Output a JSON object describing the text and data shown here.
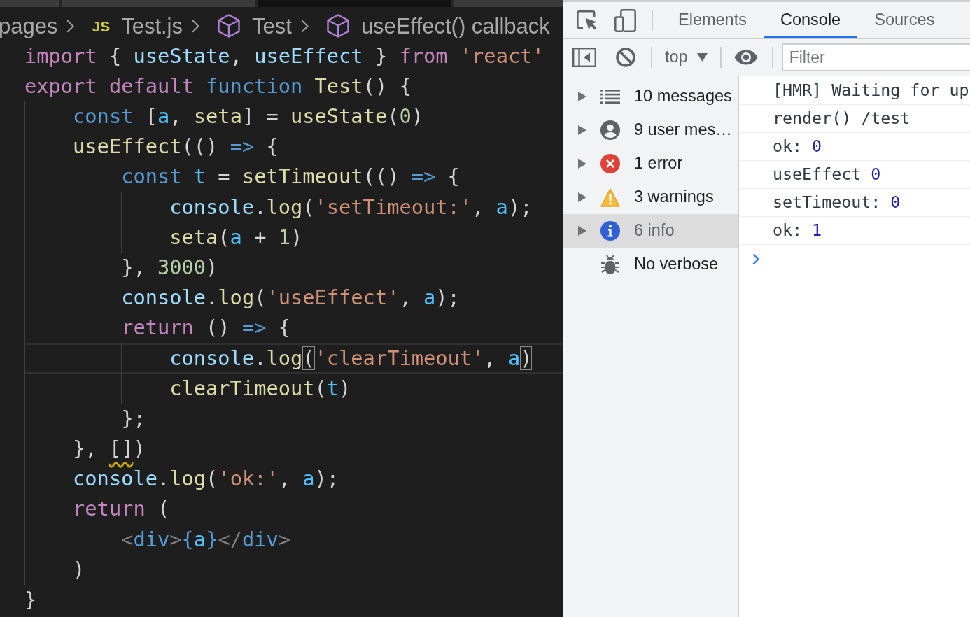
{
  "editor": {
    "tabs": [
      {
        "selected": false
      },
      {
        "selected": false
      },
      {
        "selected": true
      },
      {
        "selected": false
      }
    ],
    "breadcrumb": [
      {
        "kind": "folder",
        "label": "pages"
      },
      {
        "kind": "file",
        "icon_text": "JS",
        "label": "Test.js"
      },
      {
        "kind": "symbol",
        "label": "Test"
      },
      {
        "kind": "symbol",
        "label": "useEffect() callback"
      }
    ],
    "lines": [
      {
        "current": false,
        "tokens": [
          {
            "kind": "keyword",
            "text": "import"
          },
          {
            "kind": "punct",
            "text": " { "
          },
          {
            "kind": "variable",
            "text": "useState"
          },
          {
            "kind": "punct",
            "text": ", "
          },
          {
            "kind": "variable",
            "text": "useEffect"
          },
          {
            "kind": "punct",
            "text": " } "
          },
          {
            "kind": "keyword",
            "text": "from "
          },
          {
            "kind": "string",
            "text": "'react'"
          }
        ]
      },
      {
        "current": false,
        "tokens": [
          {
            "kind": "keyword",
            "text": "export default "
          },
          {
            "kind": "storage",
            "text": "function "
          },
          {
            "kind": "function",
            "text": "Test"
          },
          {
            "kind": "punct",
            "text": "() {"
          }
        ],
        "children": [
          {
            "current": false,
            "tokens": [
              {
                "kind": "storage",
                "text": "const "
              },
              {
                "kind": "punct",
                "text": "["
              },
              {
                "kind": "constant",
                "text": "a"
              },
              {
                "kind": "punct",
                "text": ", "
              },
              {
                "kind": "function",
                "text": "seta"
              },
              {
                "kind": "punct",
                "text": "] = "
              },
              {
                "kind": "function",
                "text": "useState"
              },
              {
                "kind": "punct",
                "text": "("
              },
              {
                "kind": "number",
                "text": "0"
              },
              {
                "kind": "punct",
                "text": ")"
              }
            ]
          },
          {
            "current": false,
            "tokens": [
              {
                "kind": "function",
                "text": "useEffect"
              },
              {
                "kind": "punct",
                "text": "(() "
              },
              {
                "kind": "storage",
                "text": "=> "
              },
              {
                "kind": "punct",
                "text": "{"
              }
            ],
            "children": [
              {
                "current": false,
                "tokens": [
                  {
                    "kind": "storage",
                    "text": "const "
                  },
                  {
                    "kind": "constant",
                    "text": "t"
                  },
                  {
                    "kind": "punct",
                    "text": " = "
                  },
                  {
                    "kind": "function",
                    "text": "setTimeout"
                  },
                  {
                    "kind": "punct",
                    "text": "(() "
                  },
                  {
                    "kind": "storage",
                    "text": "=> "
                  },
                  {
                    "kind": "punct",
                    "text": "{"
                  }
                ],
                "children": [
                  {
                    "current": false,
                    "tokens": [
                      {
                        "kind": "variable",
                        "text": "console"
                      },
                      {
                        "kind": "punct",
                        "text": "."
                      },
                      {
                        "kind": "function",
                        "text": "log"
                      },
                      {
                        "kind": "punct",
                        "text": "("
                      },
                      {
                        "kind": "string",
                        "text": "'setTimeout:'"
                      },
                      {
                        "kind": "punct",
                        "text": ", "
                      },
                      {
                        "kind": "constant",
                        "text": "a"
                      },
                      {
                        "kind": "punct",
                        "text": ");"
                      }
                    ]
                  },
                  {
                    "current": false,
                    "tokens": [
                      {
                        "kind": "function",
                        "text": "seta"
                      },
                      {
                        "kind": "punct",
                        "text": "("
                      },
                      {
                        "kind": "constant",
                        "text": "a"
                      },
                      {
                        "kind": "punct",
                        "text": " + "
                      },
                      {
                        "kind": "number",
                        "text": "1"
                      },
                      {
                        "kind": "punct",
                        "text": ")"
                      }
                    ]
                  }
                ]
              },
              {
                "current": false,
                "tokens": [
                  {
                    "kind": "punct",
                    "text": "}, "
                  },
                  {
                    "kind": "number",
                    "text": "3000"
                  },
                  {
                    "kind": "punct",
                    "text": ")"
                  }
                ]
              },
              {
                "current": false,
                "tokens": [
                  {
                    "kind": "variable",
                    "text": "console"
                  },
                  {
                    "kind": "punct",
                    "text": "."
                  },
                  {
                    "kind": "function",
                    "text": "log"
                  },
                  {
                    "kind": "punct",
                    "text": "("
                  },
                  {
                    "kind": "string",
                    "text": "'useEffect'"
                  },
                  {
                    "kind": "punct",
                    "text": ", "
                  },
                  {
                    "kind": "constant",
                    "text": "a"
                  },
                  {
                    "kind": "punct",
                    "text": ");"
                  }
                ]
              },
              {
                "current": false,
                "tokens": [
                  {
                    "kind": "keyword",
                    "text": "return "
                  },
                  {
                    "kind": "punct",
                    "text": "() "
                  },
                  {
                    "kind": "storage",
                    "text": "=> "
                  },
                  {
                    "kind": "punct",
                    "text": "{"
                  }
                ],
                "children": [
                  {
                    "current": true,
                    "tokens": [
                      {
                        "kind": "variable",
                        "text": "console"
                      },
                      {
                        "kind": "punct",
                        "text": "."
                      },
                      {
                        "kind": "function",
                        "text": "log"
                      },
                      {
                        "kind": "bracket-match",
                        "text": "("
                      },
                      {
                        "kind": "string",
                        "text": "'clearTimeout'"
                      },
                      {
                        "kind": "punct",
                        "text": ", "
                      },
                      {
                        "kind": "constant",
                        "text": "a"
                      },
                      {
                        "kind": "bracket-match",
                        "text": ")"
                      }
                    ]
                  },
                  {
                    "current": false,
                    "tokens": [
                      {
                        "kind": "function",
                        "text": "clearTimeout"
                      },
                      {
                        "kind": "punct",
                        "text": "("
                      },
                      {
                        "kind": "constant",
                        "text": "t"
                      },
                      {
                        "kind": "punct",
                        "text": ")"
                      }
                    ]
                  }
                ]
              },
              {
                "current": false,
                "tokens": [
                  {
                    "kind": "punct",
                    "text": "};"
                  }
                ]
              }
            ]
          },
          {
            "current": false,
            "tokens": [
              {
                "kind": "punct",
                "text": "}, "
              },
              {
                "kind": "warning",
                "text": "[]"
              },
              {
                "kind": "punct",
                "text": ")"
              }
            ]
          },
          {
            "current": false,
            "tokens": [
              {
                "kind": "variable",
                "text": "console"
              },
              {
                "kind": "punct",
                "text": "."
              },
              {
                "kind": "function",
                "text": "log"
              },
              {
                "kind": "punct",
                "text": "("
              },
              {
                "kind": "string",
                "text": "'ok:'"
              },
              {
                "kind": "punct",
                "text": ", "
              },
              {
                "kind": "constant",
                "text": "a"
              },
              {
                "kind": "punct",
                "text": ");"
              }
            ]
          },
          {
            "current": false,
            "tokens": [
              {
                "kind": "keyword",
                "text": "return "
              },
              {
                "kind": "punct",
                "text": "("
              }
            ],
            "children": [
              {
                "current": false,
                "tokens": [
                  {
                    "kind": "tag-bracket",
                    "text": "<"
                  },
                  {
                    "kind": "tag",
                    "text": "div"
                  },
                  {
                    "kind": "tag-bracket",
                    "text": ">"
                  },
                  {
                    "kind": "storage",
                    "text": "{"
                  },
                  {
                    "kind": "constant",
                    "text": "a"
                  },
                  {
                    "kind": "storage",
                    "text": "}"
                  },
                  {
                    "kind": "tag-bracket",
                    "text": "</"
                  },
                  {
                    "kind": "tag",
                    "text": "div"
                  },
                  {
                    "kind": "tag-bracket",
                    "text": ">"
                  }
                ]
              }
            ]
          },
          {
            "current": false,
            "tokens": [
              {
                "kind": "punct",
                "text": ")"
              }
            ]
          }
        ]
      },
      {
        "current": false,
        "tokens": [
          {
            "kind": "punct",
            "text": "}"
          }
        ]
      }
    ]
  },
  "devtools": {
    "tabs": [
      {
        "label": "Elements",
        "selected": false
      },
      {
        "label": "Console",
        "selected": true
      },
      {
        "label": "Sources",
        "selected": false
      }
    ],
    "context": "top",
    "filter": {
      "placeholder": "Filter"
    },
    "sidebar": [
      {
        "kind": "messages",
        "label": "10 messages",
        "expandable": true,
        "selected": false
      },
      {
        "kind": "user",
        "label": "9 user mes…",
        "expandable": true,
        "selected": false
      },
      {
        "kind": "error",
        "label": "1 error",
        "expandable": true,
        "selected": false
      },
      {
        "kind": "warning",
        "label": "3 warnings",
        "expandable": true,
        "selected": false
      },
      {
        "kind": "info",
        "label": "6 info",
        "expandable": true,
        "selected": true
      },
      {
        "kind": "verbose",
        "label": "No verbose",
        "expandable": false,
        "selected": false
      }
    ],
    "messages": [
      {
        "text": "[HMR] Waiting for up"
      },
      {
        "text": "render() /test"
      },
      {
        "text": "ok:",
        "value": "0"
      },
      {
        "text": "useEffect",
        "value": "0"
      },
      {
        "text": "setTimeout:",
        "value": "0"
      },
      {
        "text": "ok:",
        "value": "1"
      }
    ]
  }
}
